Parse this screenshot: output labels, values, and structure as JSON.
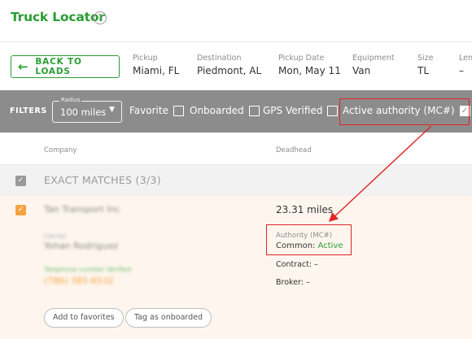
{
  "header": {
    "title": "Truck Locator",
    "help_icon": "?"
  },
  "load": {
    "back_label": "BACK TO LOADS",
    "back_icon": "←",
    "columns": [
      {
        "label": "Pickup",
        "value": "Miami, FL"
      },
      {
        "label": "Destination",
        "value": "Piedmont, AL"
      },
      {
        "label": "Pickup Date",
        "value": "Mon, May 11"
      },
      {
        "label": "Equipment",
        "value": "Van"
      },
      {
        "label": "Size",
        "value": "TL"
      },
      {
        "label": "Len",
        "value": "–"
      }
    ]
  },
  "filters": {
    "label": "FILTERS",
    "radius_label": "Radius",
    "radius_value": "100 miles",
    "checks": [
      {
        "label": "Favorite",
        "checked": false
      },
      {
        "label": "Onboarded",
        "checked": false
      },
      {
        "label": "GPS Verified",
        "checked": false
      },
      {
        "label": "Active authority (MC#)",
        "checked": true
      }
    ]
  },
  "table": {
    "headers": {
      "company": "Company",
      "deadhead": "Deadhead"
    },
    "group_title": "EXACT MATCHES (3/3)",
    "row": {
      "company": "Tan Transport Inc",
      "carrier_label": "Carrier",
      "carrier_name": "Yohan Rodriguez",
      "phone_label": "Telephone number Verified",
      "phone": "(786) 385-6532",
      "deadhead": "23.31 miles",
      "authority_label": "Authority (MC#)",
      "authority_prefix": "Common: ",
      "authority_status": "Active",
      "contract": "Contract: –",
      "broker": "Broker: –",
      "favorite_btn": "Add to favorites",
      "onboard_btn": "Tag as onboarded"
    }
  },
  "colors": {
    "accent": "#2a9d32",
    "filter_bar": "#8c8c8c",
    "highlight": "#e02424",
    "row_bg": "#fef6ee",
    "check_orange": "#f4a340"
  }
}
